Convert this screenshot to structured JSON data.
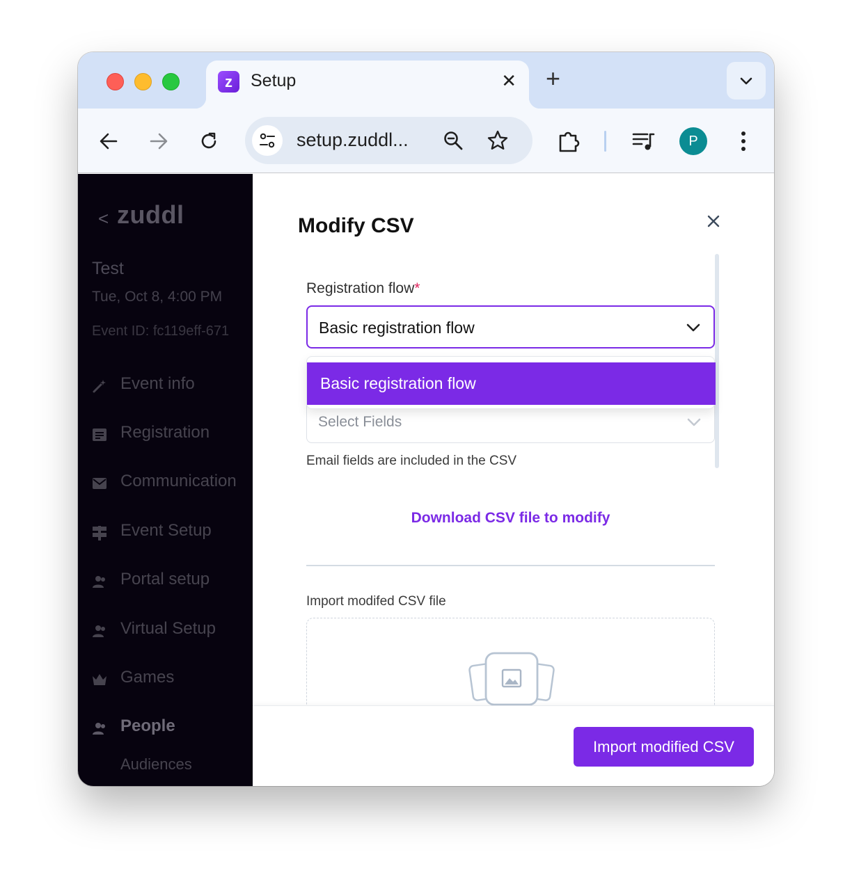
{
  "browser": {
    "tab_title": "Setup",
    "favicon_letter": "z",
    "tab_close_glyph": "✕",
    "new_tab_glyph": "+",
    "url": "setup.zuddl...",
    "profile_initial": "P",
    "icons": [
      "back-icon",
      "forward-icon",
      "reload-icon",
      "site-settings-icon",
      "zoom-icon",
      "bookmark-star-icon",
      "extensions-icon",
      "media-playlist-icon",
      "kebab-menu-icon",
      "tab-search-chevron-icon"
    ]
  },
  "sidebar": {
    "back_glyph": "<",
    "logo": "zuddl",
    "event_name": "Test",
    "event_date": "Tue, Oct 8, 4:00 PM",
    "event_id": "Event ID: fc119eff-671",
    "items": [
      {
        "label": "Event info",
        "icon": "magic-wand-icon"
      },
      {
        "label": "Registration",
        "icon": "form-icon"
      },
      {
        "label": "Communication",
        "icon": "mail-icon"
      },
      {
        "label": "Event Setup",
        "icon": "signpost-icon"
      },
      {
        "label": "Portal setup",
        "icon": "people-icon"
      },
      {
        "label": "Virtual Setup",
        "icon": "people-icon"
      },
      {
        "label": "Games",
        "icon": "crown-icon"
      },
      {
        "label": "People",
        "icon": "people-icon"
      },
      {
        "label": "Audiences",
        "icon": ""
      }
    ]
  },
  "modal": {
    "title": "Modify CSV",
    "registration_label": "Registration flow",
    "required_mark": "*",
    "registration_value": "Basic registration flow",
    "dropdown_options": [
      "Basic registration flow"
    ],
    "fields_placeholder": "Select Fields",
    "helper_text": "Email fields are included in the CSV",
    "download_link": "Download CSV file to modify",
    "import_label": "Import modifed CSV file",
    "import_button": "Import modified CSV"
  },
  "colors": {
    "accent": "#7b2ae6",
    "sidebar_bg": "#07030f",
    "required": "#e0245e",
    "tabstrip_bg": "#d3e1f7",
    "avatar_bg": "#0b8c93"
  }
}
